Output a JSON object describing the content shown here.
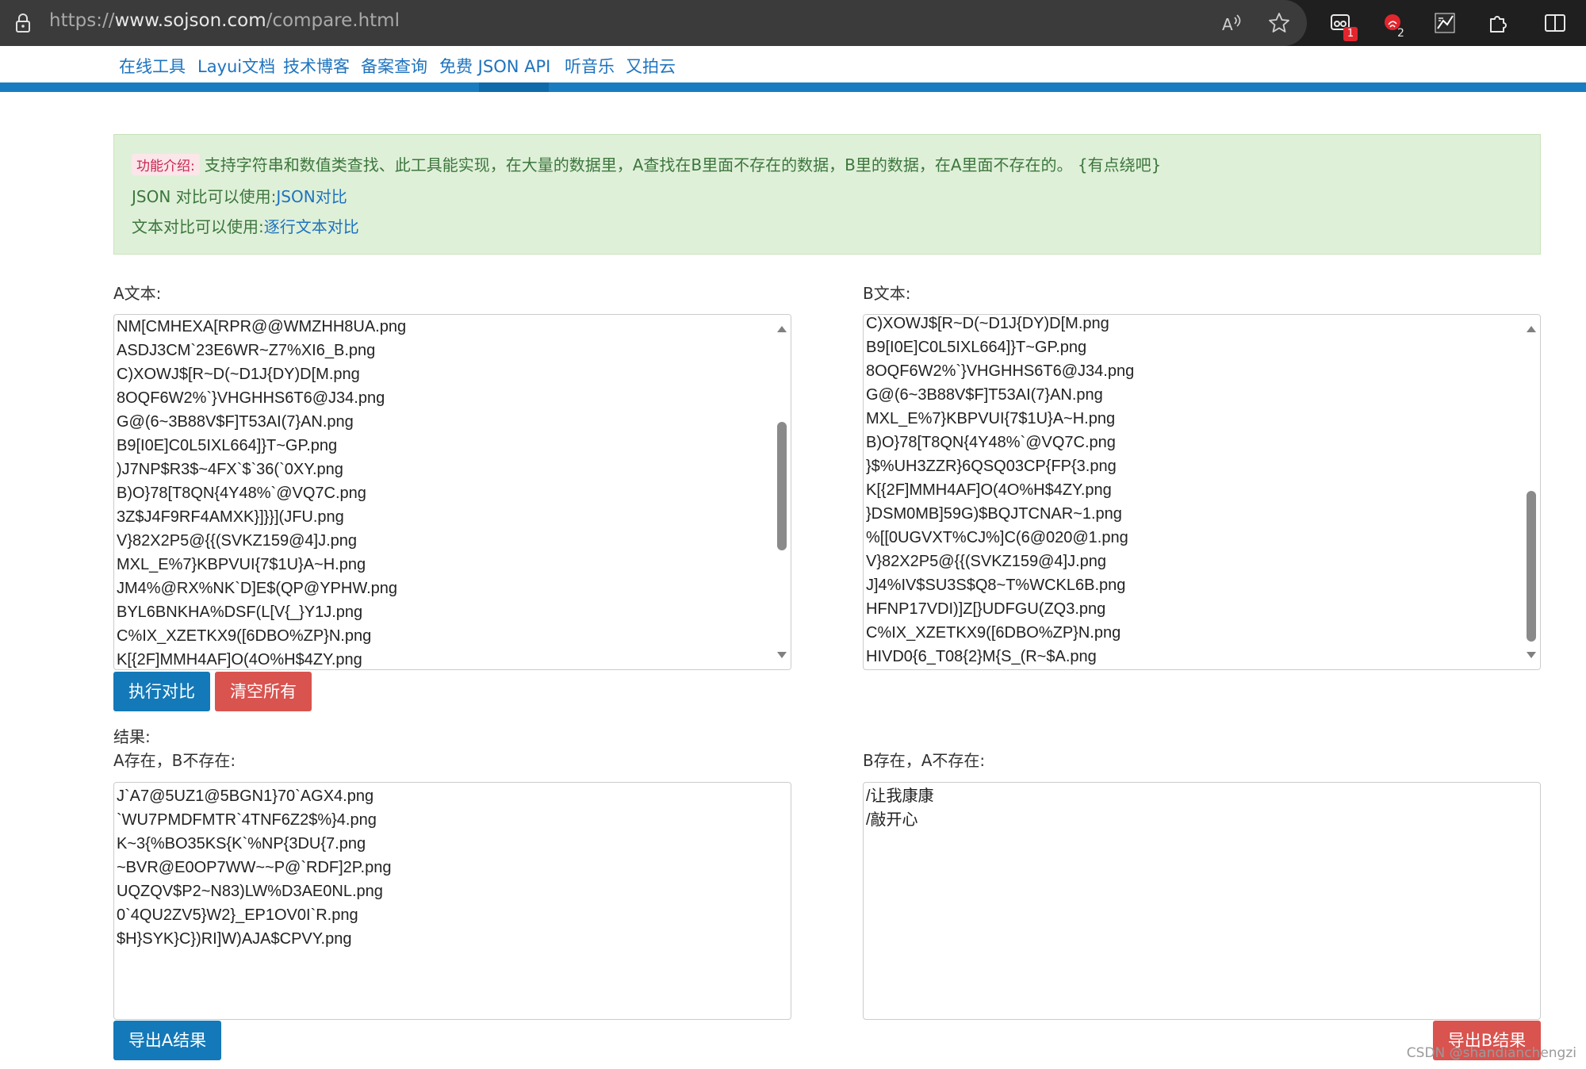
{
  "browser": {
    "url_prefix": "https://",
    "url_host": "www.sojson.com",
    "url_path": "/compare.html",
    "badge_1": "1",
    "badge_2": "2"
  },
  "nav": {
    "items": [
      "在线工具",
      "Layui文档",
      "技术博客",
      "备案查询",
      "免费 JSON API",
      "听音乐",
      "又拍云"
    ]
  },
  "intro": {
    "tag": "功能介绍:",
    "description": "支持字符串和数值类查找、此工具能实现，在大量的数据里，A查找在B里面不存在的数据，B里的数据，在A里面不存在的。 {有点绕吧}",
    "json_prefix": "JSON 对比可以使用:",
    "json_link": "JSON对比",
    "text_prefix": "文本对比可以使用:",
    "text_link": "逐行文本对比"
  },
  "a_text": {
    "label": "A文本:",
    "lines": [
      "NM[CMHEXA[RPR@@WMZHH8UA.png",
      "ASDJ3CM`23E6WR~Z7%XI6_B.png",
      "C)XOWJ$[R~D(~D1J{DY)D[M.png",
      "8OQF6W2%`}VHGHHS6T6@J34.png",
      "G@(6~3B88V$F]T53AI(7}AN.png",
      "B9[I0E]C0L5IXL664]}T~GP.png",
      ")J7NP$R3$~4FX`$`36(`0XY.png",
      "B)O}78[T8QN{4Y48%`@VQ7C.png",
      "3Z$J4F9RF4AMXK}]}}](JFU.png",
      "V}82X2P5@{{(SVKZ159@4]J.png",
      "MXL_E%7}KBPVUI{7$1U}A~H.png",
      "JM4%@RX%NK`D]E$(QP@YPHW.png",
      "BYL6BNKHA%DSF(L[V{_}Y1J.png",
      "C%IX_XZETKX9([6DBO%ZP}N.png",
      "K[{2F]MMH4AF]O(4O%H$4ZY.png"
    ]
  },
  "b_text": {
    "label": "B文本:",
    "lines": [
      "C)XOWJ$[R~D(~D1J{DY)D[M.png",
      "B9[I0E]C0L5IXL664]}T~GP.png",
      "8OQF6W2%`}VHGHHS6T6@J34.png",
      "G@(6~3B88V$F]T53AI(7}AN.png",
      "MXL_E%7}KBPVUI{7$1U}A~H.png",
      "B)O}78[T8QN{4Y48%`@VQ7C.png",
      "}$%UH3ZZR}6QSQ03CP{FP{3.png",
      "K[{2F]MMH4AF]O(4O%H$4ZY.png",
      "}DSM0MB]59G)$BQJTCNAR~1.png",
      "%[[0UGVXT%CJ%]C(6@020@1.png",
      "V}82X2P5@{{(SVKZ159@4]J.png",
      "J]4%IV$SU3S$Q8~T%WCKL6B.png",
      "HFNP17VDI)]Z[}UDFGU(ZQ3.png",
      "C%IX_XZETKX9([6DBO%ZP}N.png",
      "HIVD0{6_T08{2}M{S_(R~$A.png"
    ]
  },
  "buttons": {
    "compare": "执行对比",
    "clear": "清空所有",
    "export_a": "导出A结果",
    "export_b": "导出B结果"
  },
  "result": {
    "title": "结果:",
    "a_label": "A存在，B不存在:",
    "b_label": "B存在，A不存在:",
    "a_lines": [
      "J`A7@5UZ1@5BGN1}70`AGX4.png",
      "`WU7PMDFMTR`4TNF6Z2$%}4.png",
      "K~3{%BO35KS{K`%NP{3DU{7.png",
      "~BVR@E0OP7WW~~P@`RDF]2P.png",
      "UQZQV$P2~N83)LW%D3AE0NL.png",
      "0`4QU2ZV5}W2}_EP1OV0I`R.png",
      "$H}SYK}C})RI]W)AJA$CPVY.png"
    ],
    "b_lines": [
      "/让我康康",
      "/敲开心"
    ]
  },
  "watermark": "CSDN @shandianchengzi",
  "colors": {
    "accent_blue": "#1479b8",
    "danger_red": "#d9534f",
    "intro_bg": "#dff0d8",
    "intro_text": "#3c763d",
    "link": "#1e73be"
  },
  "icons": [
    "lock-icon",
    "read-aloud-icon",
    "favorite-star-icon",
    "extension-1-icon",
    "extension-2-icon",
    "extension-3-icon",
    "extensions-puzzle-icon",
    "split-screen-icon"
  ]
}
